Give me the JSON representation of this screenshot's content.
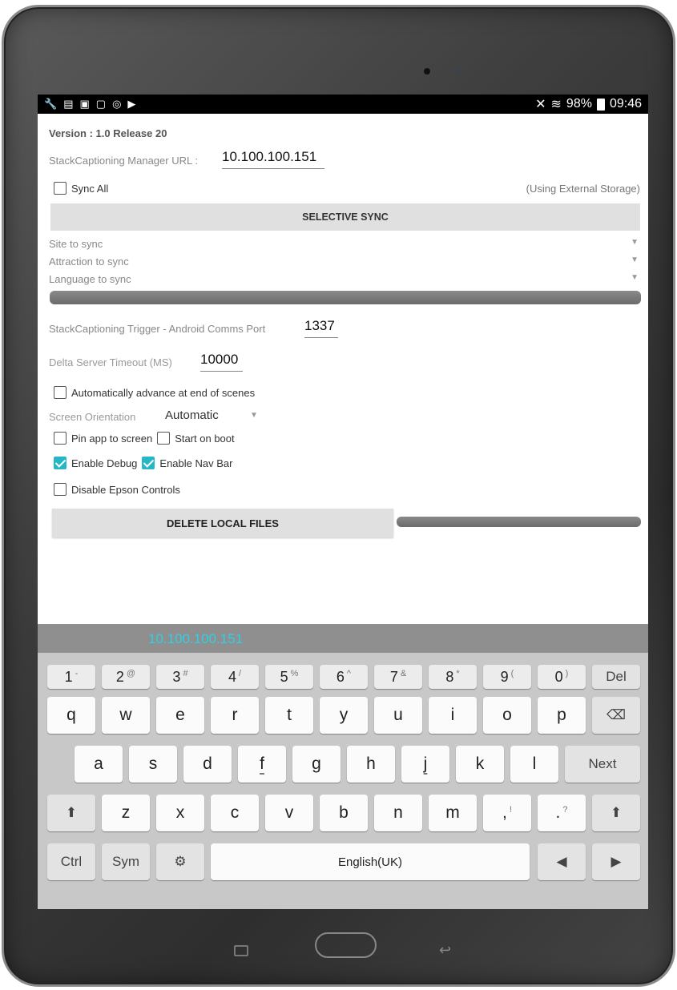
{
  "status_bar": {
    "left_icons": [
      "wrench-icon",
      "message-icon",
      "image-icon",
      "clipboard-icon",
      "sync-icon",
      "media-icon"
    ],
    "battery": "98%",
    "time": "09:46"
  },
  "app": {
    "version": "Version : 1.0 Release 20",
    "url_label": "StackCaptioning Manager URL :",
    "url_value": "10.100.100.151",
    "sync_all_label": "Sync All",
    "storage_note": "(Using External Storage)",
    "selective_sync_label": "SELECTIVE SYNC",
    "site_label": "Site to sync",
    "attraction_label": "Attraction to sync",
    "language_label": "Language to sync",
    "trigger_label": "StackCaptioning Trigger - Android Comms Port",
    "trigger_value": "1337",
    "delta_label": "Delta Server Timeout (MS)",
    "delta_value": "10000",
    "auto_advance_label": "Automatically advance at end of scenes",
    "orientation_label": "Screen Orientation",
    "orientation_value": "Automatic",
    "pin_label": "Pin app to screen",
    "boot_label": "Start on boot",
    "debug_label": "Enable Debug",
    "navbar_label": "Enable Nav Bar",
    "epson_label": "Disable Epson Controls",
    "delete_label": "DELETE LOCAL FILES"
  },
  "keyboard": {
    "preview": "10.100.100.151",
    "num_row": [
      {
        "k": "1",
        "s": "-"
      },
      {
        "k": "2",
        "s": "@"
      },
      {
        "k": "3",
        "s": "#"
      },
      {
        "k": "4",
        "s": "/"
      },
      {
        "k": "5",
        "s": "%"
      },
      {
        "k": "6",
        "s": "^"
      },
      {
        "k": "7",
        "s": "&"
      },
      {
        "k": "8",
        "s": "*"
      },
      {
        "k": "9",
        "s": "("
      },
      {
        "k": "0",
        "s": ")"
      }
    ],
    "del": "Del",
    "row1": [
      "q",
      "w",
      "e",
      "r",
      "t",
      "y",
      "u",
      "i",
      "o",
      "p"
    ],
    "row2": [
      "a",
      "s",
      "d",
      "f",
      "g",
      "h",
      "j",
      "k",
      "l"
    ],
    "next": "Next",
    "row3": [
      "z",
      "x",
      "c",
      "v",
      "b",
      "n",
      "m"
    ],
    "comma": ",",
    "comma_sup": "!",
    "period": ".",
    "period_sup": "?",
    "ctrl": "Ctrl",
    "sym": "Sym",
    "space": "English(UK)"
  },
  "checks": {
    "sync_all": false,
    "auto_advance": false,
    "pin": false,
    "boot": false,
    "debug": true,
    "navbar": true,
    "epson": false
  },
  "colors": {
    "accent": "#26b7c6",
    "preview_text": "#2fd0e6"
  }
}
